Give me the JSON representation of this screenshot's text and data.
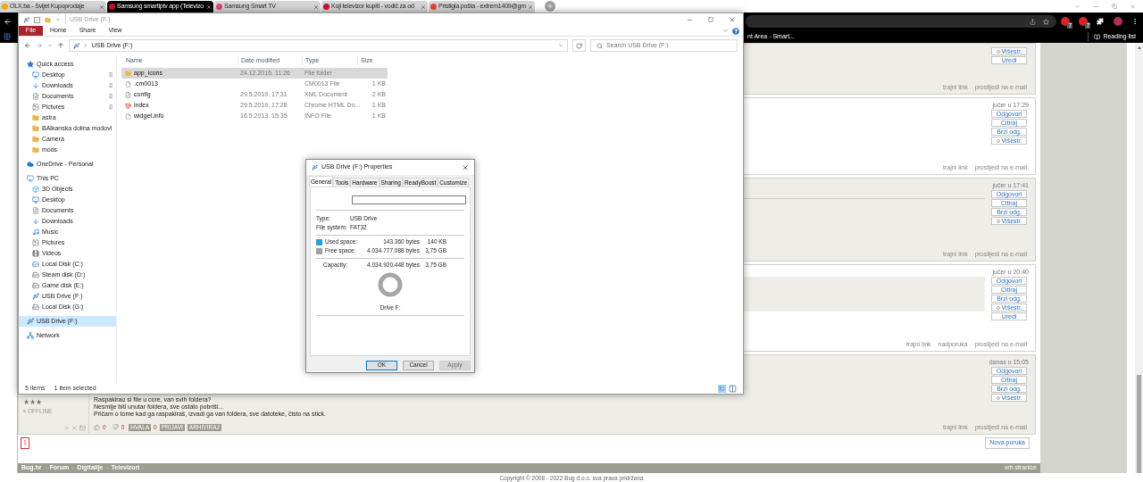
{
  "browser": {
    "tabs": [
      {
        "title": "OLX.ba - Svijet Kupoprodaje",
        "selected": false,
        "color": "#f2a900"
      },
      {
        "title": "Samsung smartiptv app (Televizo",
        "selected": true,
        "color": "#c8102e"
      },
      {
        "title": "Samsung Smart TV",
        "selected": false,
        "color": "#d9487a"
      },
      {
        "title": "Koji televizor kupiti - vodič za od",
        "selected": false,
        "color": "#c8102e"
      },
      {
        "title": "Pristigla pošta - extrem1409@gm",
        "selected": false,
        "color": "#ea4335"
      }
    ],
    "extension_badges": [
      "7",
      "7"
    ],
    "bookmark": "nt Area - Smart...",
    "reading_list": "Reading list"
  },
  "explorer": {
    "title": "USB Drive (F:)",
    "ribbon_tabs": [
      {
        "label": "File",
        "kind": "file"
      },
      {
        "label": "Home",
        "kind": "tab"
      },
      {
        "label": "Share",
        "kind": "tab"
      },
      {
        "label": "View",
        "kind": "tab"
      }
    ],
    "address": "USB Drive (F:)",
    "search_placeholder": "Search USB Drive (F:)",
    "nav": [
      {
        "label": "Quick access",
        "kind": "star",
        "selected": false,
        "children": [
          {
            "label": "Desktop",
            "kind": "desktop",
            "selected": false,
            "pinned": true
          },
          {
            "label": "Downloads",
            "kind": "downloads",
            "selected": false,
            "pinned": true
          },
          {
            "label": "Documents",
            "kind": "documents",
            "selected": false,
            "pinned": true
          },
          {
            "label": "Pictures",
            "kind": "pictures",
            "selected": false,
            "pinned": true
          },
          {
            "label": "astra",
            "kind": "folder",
            "selected": false,
            "pinned": false
          },
          {
            "label": "BAlkanska dolina modovi",
            "kind": "folder",
            "selected": false,
            "pinned": false
          },
          {
            "label": "Camera",
            "kind": "folder",
            "selected": false,
            "pinned": false
          },
          {
            "label": "mods",
            "kind": "folder",
            "selected": false,
            "pinned": false
          }
        ]
      },
      {
        "label": "OneDrive - Personal",
        "kind": "cloud",
        "selected": false
      },
      {
        "label": "This PC",
        "kind": "pc",
        "selected": false,
        "children": [
          {
            "label": "3D Objects",
            "kind": "objects",
            "selected": false
          },
          {
            "label": "Desktop",
            "kind": "desktop",
            "selected": false
          },
          {
            "label": "Documents",
            "kind": "documents",
            "selected": false
          },
          {
            "label": "Downloads",
            "kind": "downloads",
            "selected": false
          },
          {
            "label": "Music",
            "kind": "music",
            "selected": false
          },
          {
            "label": "Pictures",
            "kind": "pictures",
            "selected": false
          },
          {
            "label": "Videos",
            "kind": "videos",
            "selected": false
          },
          {
            "label": "Local Disk (C:)",
            "kind": "system-disk",
            "selected": false
          },
          {
            "label": "Steam disk (D:)",
            "kind": "disk",
            "selected": false
          },
          {
            "label": "Game disk (E:)",
            "kind": "disk",
            "selected": false
          },
          {
            "label": "USB Drive (F:)",
            "kind": "usb",
            "selected": false
          },
          {
            "label": "Local Disk (G:)",
            "kind": "disk",
            "selected": false
          }
        ]
      },
      {
        "label": "USB Drive (F:)",
        "kind": "usb",
        "selected": true
      },
      {
        "label": "Network",
        "kind": "network",
        "selected": false
      }
    ],
    "columns": [
      "Name",
      "Date modified",
      "Type",
      "Size"
    ],
    "files": [
      {
        "name": "app_icons",
        "kind": "folder",
        "date": "24.12.2016. 11:26",
        "type": "File folder",
        "selected": true
      },
      {
        "name": ".cm0013",
        "kind": "file",
        "type": "CM0013 File",
        "size": "1 KB",
        "selected": false
      },
      {
        "name": "config",
        "kind": "xml",
        "date": "29.5.2019. 17:31",
        "type": "XML Document",
        "size": "2 KB",
        "selected": false
      },
      {
        "name": "index",
        "kind": "chrome",
        "date": "29.5.2019. 17:28",
        "type": "Chrome HTML Do...",
        "size": "1 KB",
        "selected": false
      },
      {
        "name": "widget.info",
        "kind": "file",
        "date": "16.5.2013. 15:35",
        "type": "INFO File",
        "size": "1 KB",
        "selected": false
      }
    ],
    "status": {
      "count": "5 items",
      "selection": "1 item selected"
    }
  },
  "properties": {
    "title": "USB Drive (F:) Properties",
    "tabs": [
      {
        "label": "General",
        "selected": true
      },
      {
        "label": "Tools",
        "selected": false
      },
      {
        "label": "Hardware",
        "selected": false
      },
      {
        "label": "Sharing",
        "selected": false
      },
      {
        "label": "ReadyBoost",
        "selected": false
      },
      {
        "label": "Customize",
        "selected": false
      }
    ],
    "info": [
      {
        "label": "Type:",
        "value": "USB Drive"
      },
      {
        "label": "File system:",
        "value": "FAT32"
      }
    ],
    "space": [
      {
        "label": "Used space:",
        "bytes": "143.360 bytes",
        "size": "140 KB",
        "color": "#26a0da"
      },
      {
        "label": "Free space:",
        "bytes": "4.034.777.088 bytes",
        "size": "3,75 GB",
        "color": "#a0a0a0"
      }
    ],
    "capacity": {
      "label": "Capacity:",
      "bytes": "4.034.920.448 bytes",
      "size": "3,75 GB"
    },
    "drive_label": "Drive F:",
    "buttons": [
      {
        "label": "OK",
        "kind": "default"
      },
      {
        "label": "Cancel",
        "kind": "normal"
      },
      {
        "label": "Apply",
        "kind": "disabled"
      }
    ]
  },
  "forum": {
    "posts": [
      {
        "shaded": true,
        "multi_quote": {
          "label": "Višestr.",
          "checked": false
        },
        "edit": "Uredi",
        "links": [
          "trajni link",
          "proslijedi na e-mail"
        ]
      },
      {
        "shaded": false,
        "time": "jučer u 17:29",
        "actions": [
          "Odgovori",
          "Citiraj",
          "Brzi odg."
        ],
        "multi_quote": {
          "label": "Višestr.",
          "checked": false
        },
        "links": [
          "trajni link",
          "proslijedi na e-mail"
        ]
      },
      {
        "shaded": true,
        "time": "jučer u 17:41",
        "signature_rule": true,
        "actions": [
          "Odgovori",
          "Citiraj",
          "Brzi odg."
        ],
        "multi_quote": {
          "label": "Višestr.",
          "checked": false
        },
        "links": [
          "trajni link",
          "proslijedi na e-mail"
        ]
      },
      {
        "shaded": false,
        "time": "jučer u 20:40",
        "quote": true,
        "actions": [
          "Odgovori",
          "Citiraj",
          "Brzi odg."
        ],
        "multi_quote": {
          "label": "Višestr.",
          "checked": false
        },
        "edit": "Uredi",
        "links": [
          "trajni link",
          "nadporuka",
          "proslijedi na e-mail"
        ]
      },
      {
        "shaded": true,
        "time": "danas u 15:05",
        "actions": [
          "Odgovori",
          "Citiraj",
          "Brzi odg."
        ],
        "multi_quote": {
          "label": "Višestr.",
          "checked": false
        },
        "author": {
          "rank": "★★★",
          "status": "OFFLINE"
        },
        "body": [
          "Raspakirao si file u core, van svih foldera?",
          "Nesmije biti unutar foldera, sve ostalo pobriši...",
          "Pričam o tome kad ga raspakiraš, izvadi ga van foldera, sve datoteke, čisto na stick."
        ],
        "reactions": {
          "likes": "0",
          "dislikes": "0",
          "thanks_label": "HVALA",
          "thanks": "0",
          "report": "PRIJAVI",
          "archive": "ARHIVIRAJ"
        },
        "links": [
          "trajni link",
          "proslijedi na e-mail"
        ]
      }
    ],
    "pages": [
      {
        "label": "1",
        "selected": true
      }
    ],
    "new_post": "Nova poruka",
    "breadcrumbs": [
      "Bug.hr",
      "Forum",
      "Digitalije",
      "Televizori"
    ],
    "top_link": "vrh stranice",
    "copyright": "Copyright © 2008 - 2022 Bug d.o.o. sva prava pridržana"
  }
}
